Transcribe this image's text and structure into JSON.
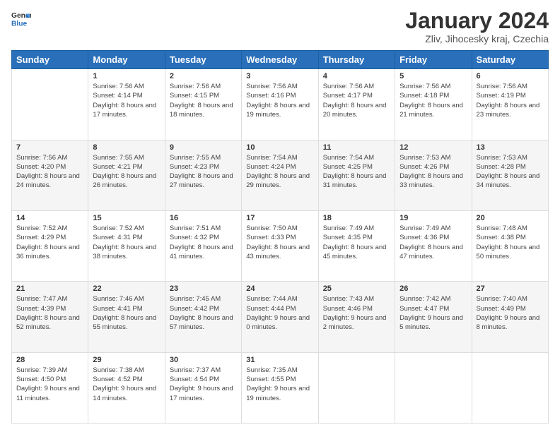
{
  "logo": {
    "line1": "General",
    "line2": "Blue"
  },
  "title": "January 2024",
  "subtitle": "Zliv, Jihocesky kraj, Czechia",
  "days_of_week": [
    "Sunday",
    "Monday",
    "Tuesday",
    "Wednesday",
    "Thursday",
    "Friday",
    "Saturday"
  ],
  "weeks": [
    [
      {
        "day": "",
        "sunrise": "",
        "sunset": "",
        "daylight": ""
      },
      {
        "day": "1",
        "sunrise": "Sunrise: 7:56 AM",
        "sunset": "Sunset: 4:14 PM",
        "daylight": "Daylight: 8 hours and 17 minutes."
      },
      {
        "day": "2",
        "sunrise": "Sunrise: 7:56 AM",
        "sunset": "Sunset: 4:15 PM",
        "daylight": "Daylight: 8 hours and 18 minutes."
      },
      {
        "day": "3",
        "sunrise": "Sunrise: 7:56 AM",
        "sunset": "Sunset: 4:16 PM",
        "daylight": "Daylight: 8 hours and 19 minutes."
      },
      {
        "day": "4",
        "sunrise": "Sunrise: 7:56 AM",
        "sunset": "Sunset: 4:17 PM",
        "daylight": "Daylight: 8 hours and 20 minutes."
      },
      {
        "day": "5",
        "sunrise": "Sunrise: 7:56 AM",
        "sunset": "Sunset: 4:18 PM",
        "daylight": "Daylight: 8 hours and 21 minutes."
      },
      {
        "day": "6",
        "sunrise": "Sunrise: 7:56 AM",
        "sunset": "Sunset: 4:19 PM",
        "daylight": "Daylight: 8 hours and 23 minutes."
      }
    ],
    [
      {
        "day": "7",
        "sunrise": "Sunrise: 7:56 AM",
        "sunset": "Sunset: 4:20 PM",
        "daylight": "Daylight: 8 hours and 24 minutes."
      },
      {
        "day": "8",
        "sunrise": "Sunrise: 7:55 AM",
        "sunset": "Sunset: 4:21 PM",
        "daylight": "Daylight: 8 hours and 26 minutes."
      },
      {
        "day": "9",
        "sunrise": "Sunrise: 7:55 AM",
        "sunset": "Sunset: 4:23 PM",
        "daylight": "Daylight: 8 hours and 27 minutes."
      },
      {
        "day": "10",
        "sunrise": "Sunrise: 7:54 AM",
        "sunset": "Sunset: 4:24 PM",
        "daylight": "Daylight: 8 hours and 29 minutes."
      },
      {
        "day": "11",
        "sunrise": "Sunrise: 7:54 AM",
        "sunset": "Sunset: 4:25 PM",
        "daylight": "Daylight: 8 hours and 31 minutes."
      },
      {
        "day": "12",
        "sunrise": "Sunrise: 7:53 AM",
        "sunset": "Sunset: 4:26 PM",
        "daylight": "Daylight: 8 hours and 33 minutes."
      },
      {
        "day": "13",
        "sunrise": "Sunrise: 7:53 AM",
        "sunset": "Sunset: 4:28 PM",
        "daylight": "Daylight: 8 hours and 34 minutes."
      }
    ],
    [
      {
        "day": "14",
        "sunrise": "Sunrise: 7:52 AM",
        "sunset": "Sunset: 4:29 PM",
        "daylight": "Daylight: 8 hours and 36 minutes."
      },
      {
        "day": "15",
        "sunrise": "Sunrise: 7:52 AM",
        "sunset": "Sunset: 4:31 PM",
        "daylight": "Daylight: 8 hours and 38 minutes."
      },
      {
        "day": "16",
        "sunrise": "Sunrise: 7:51 AM",
        "sunset": "Sunset: 4:32 PM",
        "daylight": "Daylight: 8 hours and 41 minutes."
      },
      {
        "day": "17",
        "sunrise": "Sunrise: 7:50 AM",
        "sunset": "Sunset: 4:33 PM",
        "daylight": "Daylight: 8 hours and 43 minutes."
      },
      {
        "day": "18",
        "sunrise": "Sunrise: 7:49 AM",
        "sunset": "Sunset: 4:35 PM",
        "daylight": "Daylight: 8 hours and 45 minutes."
      },
      {
        "day": "19",
        "sunrise": "Sunrise: 7:49 AM",
        "sunset": "Sunset: 4:36 PM",
        "daylight": "Daylight: 8 hours and 47 minutes."
      },
      {
        "day": "20",
        "sunrise": "Sunrise: 7:48 AM",
        "sunset": "Sunset: 4:38 PM",
        "daylight": "Daylight: 8 hours and 50 minutes."
      }
    ],
    [
      {
        "day": "21",
        "sunrise": "Sunrise: 7:47 AM",
        "sunset": "Sunset: 4:39 PM",
        "daylight": "Daylight: 8 hours and 52 minutes."
      },
      {
        "day": "22",
        "sunrise": "Sunrise: 7:46 AM",
        "sunset": "Sunset: 4:41 PM",
        "daylight": "Daylight: 8 hours and 55 minutes."
      },
      {
        "day": "23",
        "sunrise": "Sunrise: 7:45 AM",
        "sunset": "Sunset: 4:42 PM",
        "daylight": "Daylight: 8 hours and 57 minutes."
      },
      {
        "day": "24",
        "sunrise": "Sunrise: 7:44 AM",
        "sunset": "Sunset: 4:44 PM",
        "daylight": "Daylight: 9 hours and 0 minutes."
      },
      {
        "day": "25",
        "sunrise": "Sunrise: 7:43 AM",
        "sunset": "Sunset: 4:46 PM",
        "daylight": "Daylight: 9 hours and 2 minutes."
      },
      {
        "day": "26",
        "sunrise": "Sunrise: 7:42 AM",
        "sunset": "Sunset: 4:47 PM",
        "daylight": "Daylight: 9 hours and 5 minutes."
      },
      {
        "day": "27",
        "sunrise": "Sunrise: 7:40 AM",
        "sunset": "Sunset: 4:49 PM",
        "daylight": "Daylight: 9 hours and 8 minutes."
      }
    ],
    [
      {
        "day": "28",
        "sunrise": "Sunrise: 7:39 AM",
        "sunset": "Sunset: 4:50 PM",
        "daylight": "Daylight: 9 hours and 11 minutes."
      },
      {
        "day": "29",
        "sunrise": "Sunrise: 7:38 AM",
        "sunset": "Sunset: 4:52 PM",
        "daylight": "Daylight: 9 hours and 14 minutes."
      },
      {
        "day": "30",
        "sunrise": "Sunrise: 7:37 AM",
        "sunset": "Sunset: 4:54 PM",
        "daylight": "Daylight: 9 hours and 17 minutes."
      },
      {
        "day": "31",
        "sunrise": "Sunrise: 7:35 AM",
        "sunset": "Sunset: 4:55 PM",
        "daylight": "Daylight: 9 hours and 19 minutes."
      },
      {
        "day": "",
        "sunrise": "",
        "sunset": "",
        "daylight": ""
      },
      {
        "day": "",
        "sunrise": "",
        "sunset": "",
        "daylight": ""
      },
      {
        "day": "",
        "sunrise": "",
        "sunset": "",
        "daylight": ""
      }
    ]
  ]
}
